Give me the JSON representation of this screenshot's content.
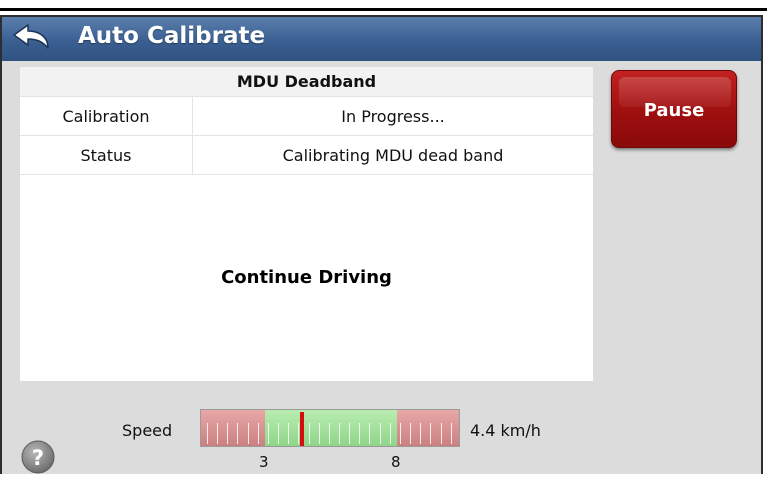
{
  "header": {
    "title": "Auto Calibrate"
  },
  "table": {
    "heading": "MDU Deadband",
    "rows": [
      {
        "label": "Calibration",
        "value": "In Progress..."
      },
      {
        "label": "Status",
        "value": "Calibrating MDU dead band"
      }
    ]
  },
  "message": "Continue Driving",
  "pause_label": "Pause",
  "speed": {
    "label": "Speed",
    "value_text": "4.4 km/h",
    "value": 4.4,
    "unit": "km/h",
    "target_min": 3,
    "target_max": 8,
    "range_min_label": "3",
    "range_max_label": "8"
  },
  "icons": {
    "back": "back-arrow-icon",
    "help": "help-icon"
  },
  "colors": {
    "titlebar": "#3b5f91",
    "pause": "#a51111",
    "needle": "#d40d0d",
    "ok_zone": "#9fdf98",
    "warn_zone": "#d99191"
  }
}
